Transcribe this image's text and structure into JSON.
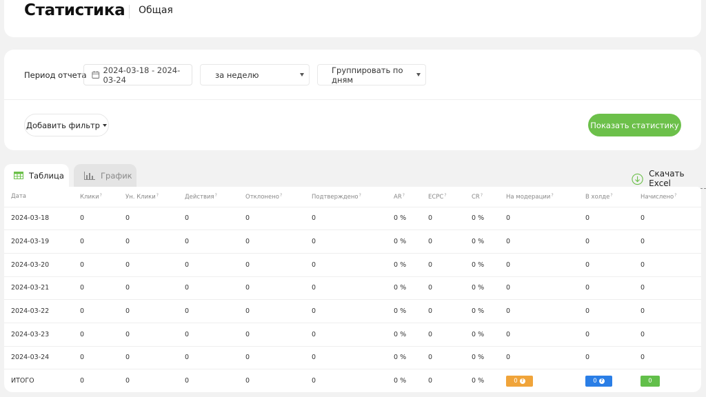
{
  "header": {
    "title": "Статистика",
    "subtitle": "Общая"
  },
  "filters": {
    "period_label": "Период отчета",
    "date_range": "2024-03-18 - 2024-03-24",
    "period_select": "за неделю",
    "group_select": "Группировать по дням",
    "add_filter_label": "Добавить фильтр",
    "show_button_label": "Показать статистику"
  },
  "tabs": [
    {
      "label": "Таблица",
      "active": true,
      "icon": "table-icon"
    },
    {
      "label": "График",
      "active": false,
      "icon": "bar-chart-icon"
    }
  ],
  "download": {
    "label": "Скачать Excel",
    "icon": "download-icon"
  },
  "table": {
    "columns": [
      {
        "label": "Дата",
        "help": false
      },
      {
        "label": "Клики",
        "help": true
      },
      {
        "label": "Ун. Клики",
        "help": true
      },
      {
        "label": "Действия",
        "help": true
      },
      {
        "label": "Отклонено",
        "help": true
      },
      {
        "label": "Подтверждено",
        "help": true
      },
      {
        "label": "AR",
        "help": true
      },
      {
        "label": "ECPC",
        "help": true
      },
      {
        "label": "CR",
        "help": true
      },
      {
        "label": "На модерации",
        "help": true
      },
      {
        "label": "В холде",
        "help": true
      },
      {
        "label": "Начислено",
        "help": true
      }
    ],
    "help_mark": "?",
    "rows": [
      [
        "2024-03-18",
        "0",
        "0",
        "0",
        "0",
        "0",
        "0 %",
        "0",
        "0 %",
        "0",
        "0",
        "0"
      ],
      [
        "2024-03-19",
        "0",
        "0",
        "0",
        "0",
        "0",
        "0 %",
        "0",
        "0 %",
        "0",
        "0",
        "0"
      ],
      [
        "2024-03-20",
        "0",
        "0",
        "0",
        "0",
        "0",
        "0 %",
        "0",
        "0 %",
        "0",
        "0",
        "0"
      ],
      [
        "2024-03-21",
        "0",
        "0",
        "0",
        "0",
        "0",
        "0 %",
        "0",
        "0 %",
        "0",
        "0",
        "0"
      ],
      [
        "2024-03-22",
        "0",
        "0",
        "0",
        "0",
        "0",
        "0 %",
        "0",
        "0 %",
        "0",
        "0",
        "0"
      ],
      [
        "2024-03-23",
        "0",
        "0",
        "0",
        "0",
        "0",
        "0 %",
        "0",
        "0 %",
        "0",
        "0",
        "0"
      ],
      [
        "2024-03-24",
        "0",
        "0",
        "0",
        "0",
        "0",
        "0 %",
        "0",
        "0 %",
        "0",
        "0",
        "0"
      ]
    ],
    "total": {
      "label": "ИТОГО",
      "cells": [
        "0",
        "0",
        "0",
        "0",
        "0",
        "0 %",
        "0",
        "0 %"
      ],
      "moderation": "0",
      "hold": "0",
      "accrued": "0"
    }
  },
  "colors": {
    "primary_green": "#6cc04a",
    "badge_orange": "#f0a43a",
    "badge_blue": "#2a7ee6",
    "badge_green": "#62bf4a"
  }
}
